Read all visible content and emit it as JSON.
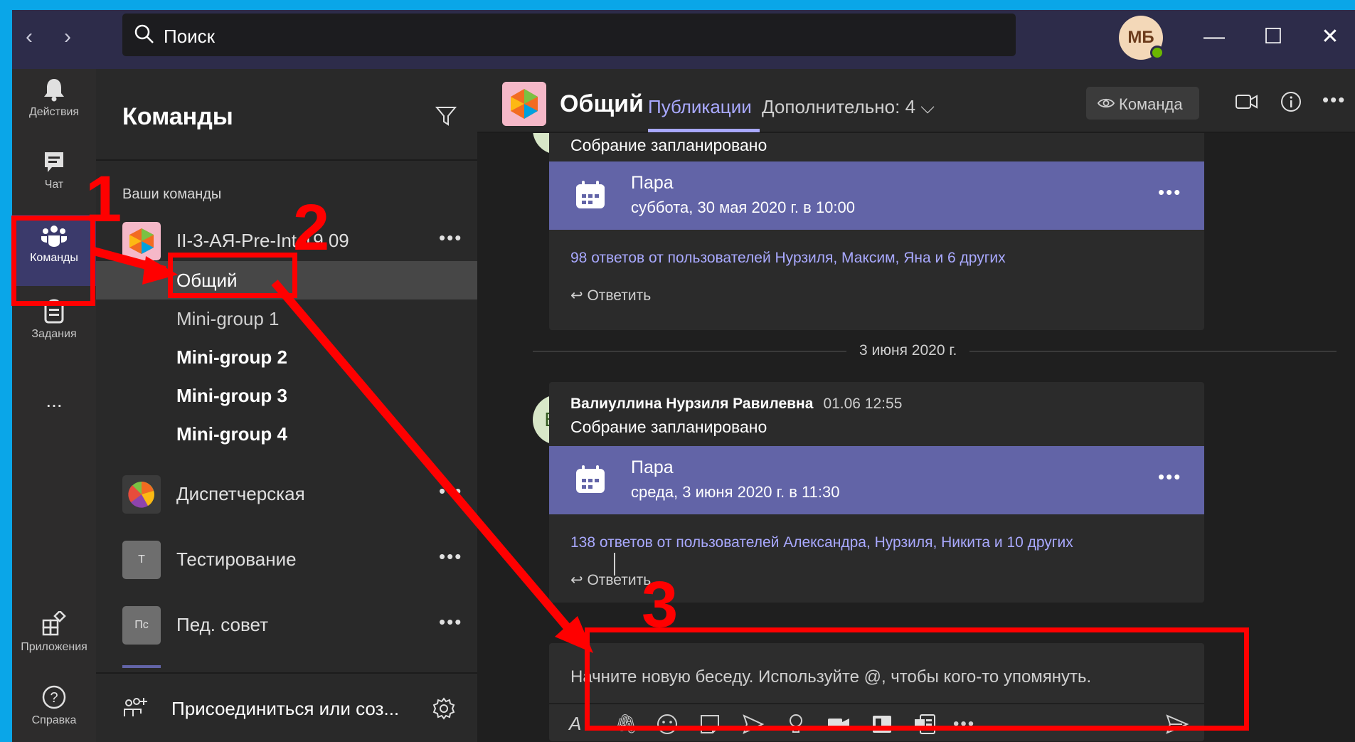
{
  "titlebar": {
    "search_placeholder": "Поиск",
    "avatar_initials": "МБ"
  },
  "rail": {
    "items": [
      {
        "label": "Действия",
        "icon": "bell-icon"
      },
      {
        "label": "Чат",
        "icon": "chat-icon"
      },
      {
        "label": "Команды",
        "icon": "teams-icon"
      },
      {
        "label": "Задания",
        "icon": "assignments-icon"
      },
      {
        "label": "...",
        "icon": "more-icon"
      }
    ],
    "bottom": [
      {
        "label": "Приложения",
        "icon": "apps-icon"
      },
      {
        "label": "Справка",
        "icon": "help-icon"
      }
    ]
  },
  "teams_panel": {
    "title": "Команды",
    "section_label": "Ваши команды",
    "teams": [
      {
        "name": "II-3-АЯ-Pre-Int-19.09"
      },
      {
        "name": "Диспетчерская"
      },
      {
        "name": "Тестирование",
        "icon_letter": "Т"
      },
      {
        "name": "Пед. совет",
        "icon_letter": "Пс"
      }
    ],
    "channels": [
      {
        "name": "Общий",
        "active": true,
        "bold": false
      },
      {
        "name": "Mini-group 1",
        "active": false,
        "bold": false
      },
      {
        "name": "Mini-group 2",
        "active": false,
        "bold": true
      },
      {
        "name": "Mini-group 3",
        "active": false,
        "bold": true
      },
      {
        "name": "Mini-group 4",
        "active": false,
        "bold": true
      }
    ],
    "join_label": "Присоединиться или соз..."
  },
  "channel_header": {
    "title": "Общий",
    "tab_active": "Публикации",
    "tab_more": "Дополнительно: 4",
    "team_button": "Команда"
  },
  "messages": {
    "first": {
      "subject": "Собрание запланировано",
      "meeting_title": "Пара",
      "meeting_time": "суббота, 30 мая 2020 г. в 10:00",
      "replies": "98 ответов от пользователей Нурзиля, Максим, Яна и 6 других",
      "reply_label": "Ответить"
    },
    "date_separator": "3 июня 2020 г.",
    "second": {
      "avatar": "ВР",
      "author": "Валиуллина Нурзиля Равилевна",
      "time": "01.06 12:55",
      "subject": "Собрание запланировано",
      "meeting_title": "Пара",
      "meeting_time": "среда, 3 июня 2020 г. в 11:30",
      "replies": "138 ответов от пользователей Александра, Нурзиля, Никита и 10 других",
      "reply_label": "Ответить"
    }
  },
  "compose": {
    "placeholder": "Начните новую беседу. Используйте @, чтобы кого-то упомянуть."
  },
  "annotations": {
    "step1": "1",
    "step2": "2",
    "step3": "3",
    "color": "#ff0000"
  },
  "colors": {
    "accent": "#6264a7",
    "accent_text": "#a9a9ff",
    "titlebar": "#2d2c4a"
  }
}
